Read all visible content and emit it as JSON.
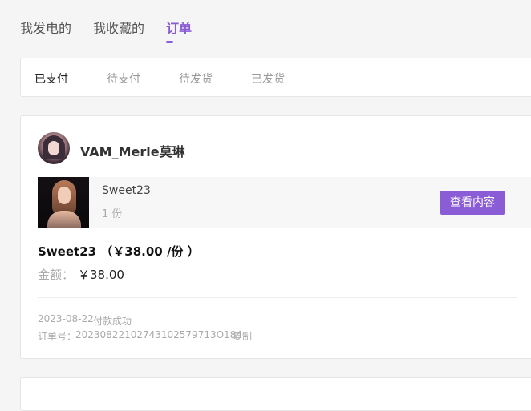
{
  "top_tabs": [
    "我发电的",
    "我收藏的",
    "订单"
  ],
  "filters": [
    "已支付",
    "待支付",
    "待发货",
    "已发货"
  ],
  "order": {
    "seller_name": "VAM_Merle莫琳",
    "product_title": "Sweet23",
    "product_qty": "1 份",
    "view_button": "查看内容",
    "summary": "Sweet23 （￥38.00 /份 ）",
    "amount_label": "金额：",
    "amount_value": "￥38.00",
    "date": "2023-08-22",
    "status": "付款成功",
    "order_no_label": "订单号：",
    "order_no": "20230822102743102579713O184",
    "copy_label": "复制"
  },
  "colors": {
    "accent": "#8a5cd6"
  }
}
